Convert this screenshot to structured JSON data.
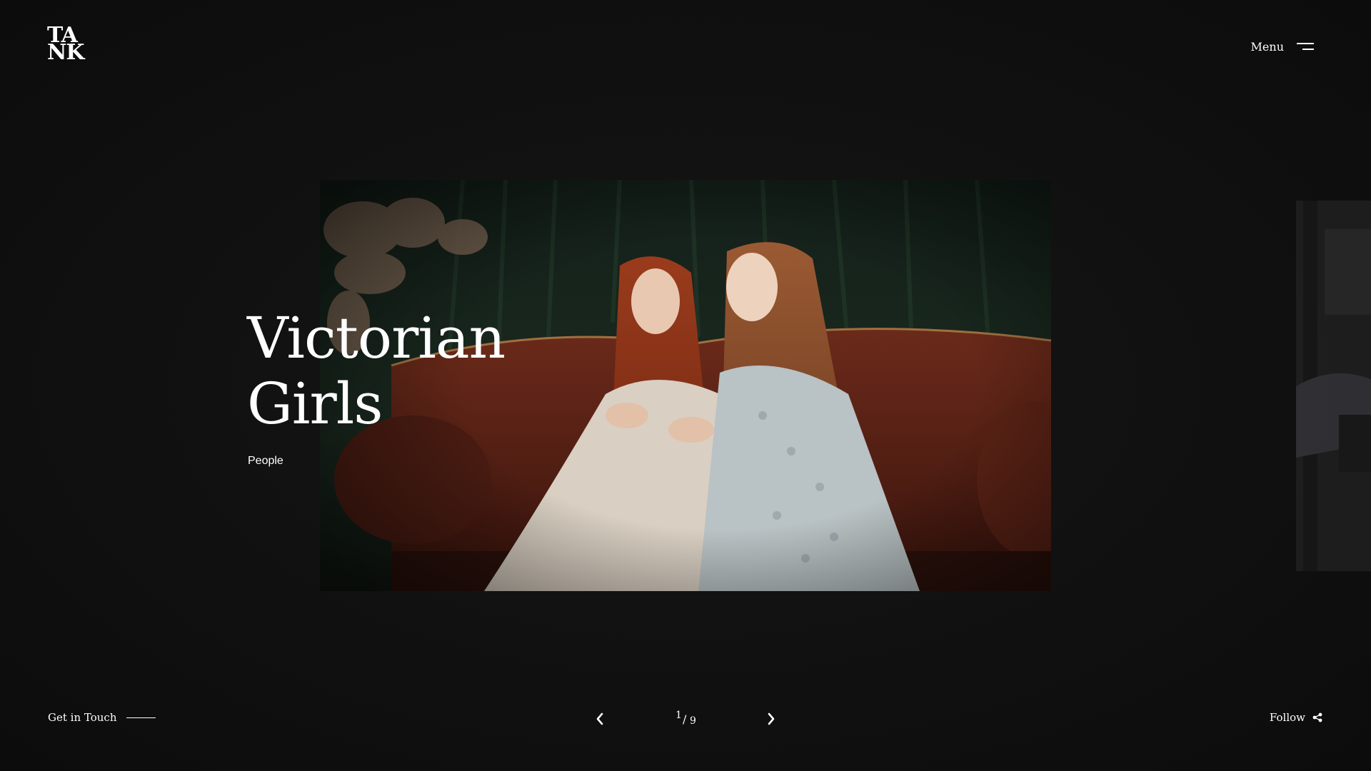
{
  "header": {
    "logo_line1": "TA",
    "logo_line2": "NK",
    "menu_label": "Menu"
  },
  "slide": {
    "title_line1": "Victorian",
    "title_line2": "Girls",
    "category": "People",
    "image_description_icon": "photo-two-women-on-sofa"
  },
  "footer": {
    "contact_label": "Get in Touch",
    "counter_current": "1",
    "counter_separator": "/",
    "counter_total": "9",
    "follow_label": "Follow"
  },
  "icons": {
    "menu": "hamburger-icon",
    "prev": "chevron-left-icon",
    "next": "chevron-right-icon",
    "share": "share-icon"
  },
  "colors": {
    "background": "#0f0f0f",
    "text": "#ffffff"
  }
}
